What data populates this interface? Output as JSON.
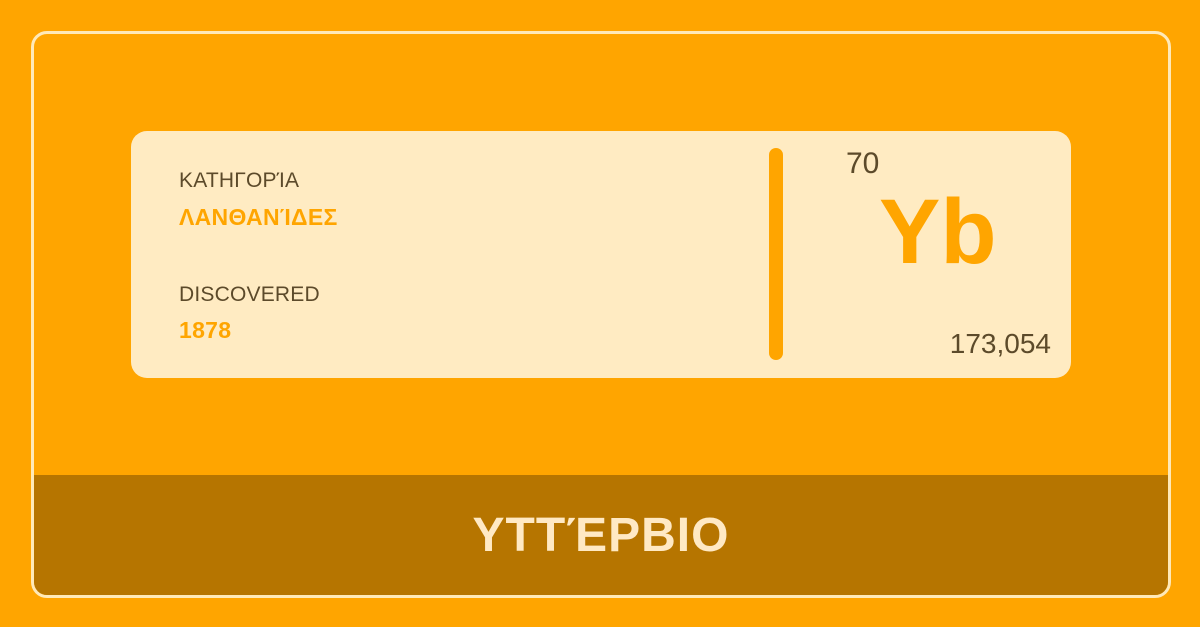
{
  "category": {
    "label": "ΚΑΤΗΓΟΡΊΑ",
    "value": "ΛΑΝΘΑΝΊΔΕΣ"
  },
  "discovered": {
    "label": "DISCOVERED",
    "value": "1878"
  },
  "element": {
    "atomic_number": "70",
    "symbol": "Yb",
    "atomic_mass": "173,054",
    "name": "ΥΤΤΈΡΒΙΟ"
  },
  "colors": {
    "background": "#FFA500",
    "panel": "#FFEBC2",
    "accent": "#FFA500",
    "name_bar": "#B67500",
    "text_dark": "#5C4A2A",
    "name_text": "#FFE9C4"
  }
}
